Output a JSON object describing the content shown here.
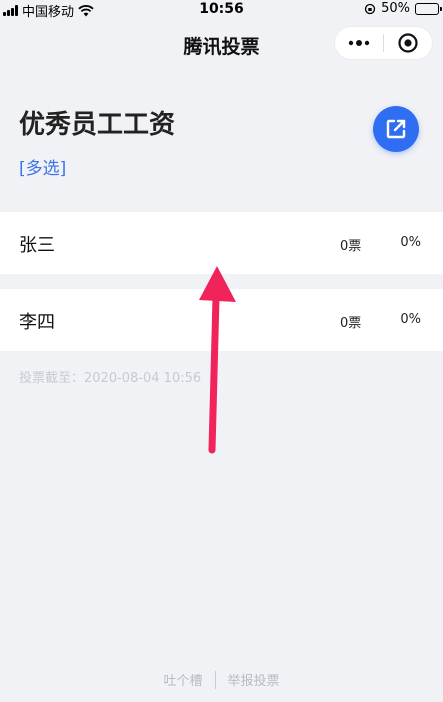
{
  "status_bar": {
    "carrier": "中国移动",
    "time": "10:56",
    "battery": "50%",
    "battery_level": 0.5
  },
  "nav": {
    "title": "腾讯投票"
  },
  "vote": {
    "title": "优秀员工工资",
    "mode": "[多选]",
    "options": [
      {
        "name": "张三",
        "votes": "0票",
        "percent": "0%"
      },
      {
        "name": "李四",
        "votes": "0票",
        "percent": "0%"
      }
    ],
    "deadline": "投票截至：2020-08-04 10:56"
  },
  "footer": {
    "feedback": "吐个槽",
    "report": "举报投票"
  },
  "colors": {
    "accent": "#2f6ef2",
    "arrow": "#f0245a",
    "background": "#f1f2f6"
  }
}
